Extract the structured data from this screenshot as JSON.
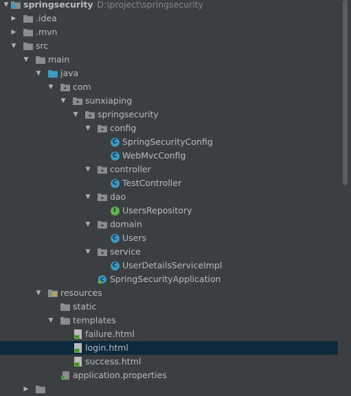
{
  "project": {
    "name": "springsecurity",
    "path": "D:\\project\\springsecurity"
  },
  "tree": {
    "idea": ".idea",
    "mvn": ".mvn",
    "src": "src",
    "main": "main",
    "java": "java",
    "com": "com",
    "sunxiaping": "sunxiaping",
    "springsecurity_pkg": "springsecurity",
    "config": "config",
    "spring_security_config": "SpringSecurityConfig",
    "web_mvc_config": "WebMvcConfig",
    "controller": "controller",
    "test_controller": "TestController",
    "dao": "dao",
    "users_repository": "UsersRepository",
    "domain": "domain",
    "users": "Users",
    "service": "service",
    "user_details_service_impl": "UserDetailsServiceImpl",
    "spring_security_application": "SpringSecurityApplication",
    "resources": "resources",
    "static": "static",
    "templates": "templates",
    "failure_html": "failure.html",
    "login_html": "login.html",
    "success_html": "success.html",
    "application_properties": "application.properties"
  },
  "colors": {
    "background": "#3c3f41",
    "selection": "#0d293e",
    "folder": "#8a8c8f",
    "class_icon": "#3d9ac4",
    "interface_icon": "#62b543"
  }
}
